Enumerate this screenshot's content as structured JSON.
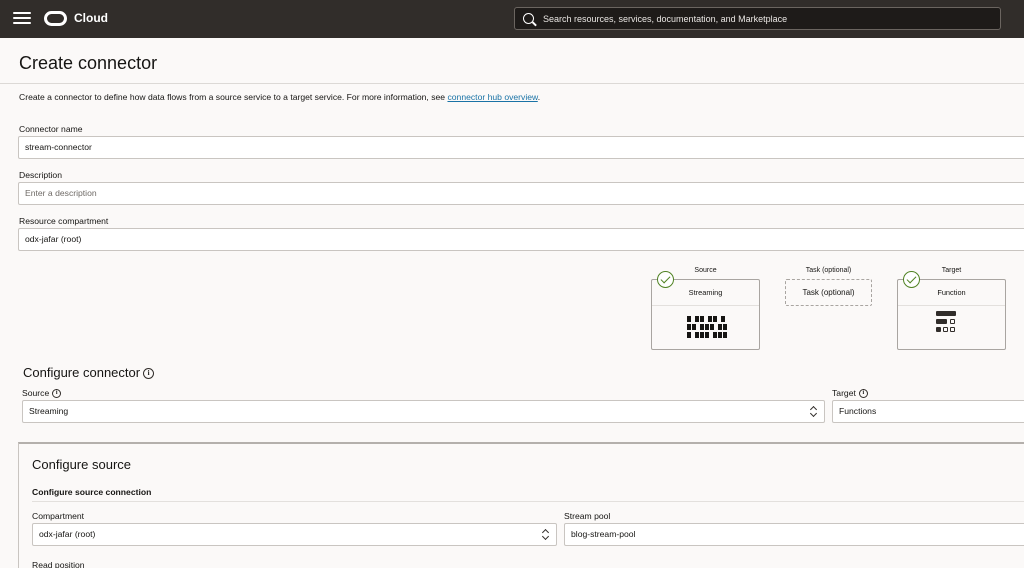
{
  "header": {
    "brand": "Cloud",
    "search_placeholder": "Search resources, services, documentation, and Marketplace"
  },
  "page": {
    "title": "Create connector",
    "intro_text": "Create a connector to define how data flows from a source service to a target service. For more information, see ",
    "intro_link": "connector hub overview",
    "intro_end": "."
  },
  "form": {
    "connector_name_label": "Connector name",
    "connector_name_value": "stream-connector",
    "description_label": "Description",
    "description_placeholder": "Enter a description",
    "compartment_label": "Resource compartment",
    "compartment_value": "odx-jafar (root)"
  },
  "flow": {
    "source_label": "Source",
    "source_card": "Streaming",
    "task_label": "Task (optional)",
    "task_card": "Task (optional)",
    "target_label": "Target",
    "target_card": "Function"
  },
  "configure_connector": {
    "title": "Configure connector",
    "source_label": "Source",
    "source_value": "Streaming",
    "target_label": "Target",
    "target_value": "Functions"
  },
  "configure_source": {
    "title": "Configure source",
    "subtitle": "Configure source connection",
    "compartment_label": "Compartment",
    "compartment_value": "odx-jafar (root)",
    "stream_pool_label": "Stream pool",
    "stream_pool_value": "blog-stream-pool",
    "read_position_label": "Read position"
  },
  "icons": {
    "info": "i",
    "menu": "hamburger-icon",
    "logo": "oracle-logo-icon",
    "search": "search-icon",
    "check": "checkmark-icon",
    "streaming": "streaming-icon",
    "function": "function-icon"
  },
  "colors": {
    "topbar": "#312d2a",
    "link": "#1a73a6",
    "check": "#508223"
  }
}
